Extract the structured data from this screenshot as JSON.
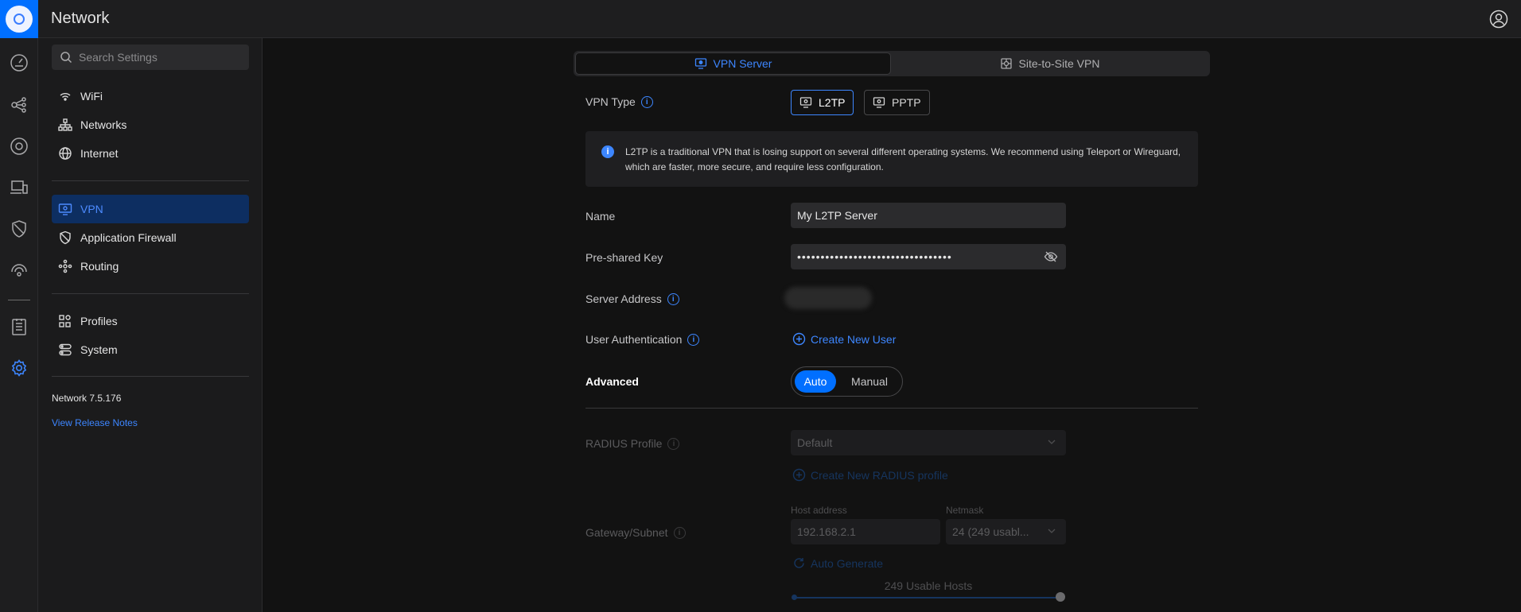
{
  "app": {
    "title": "Network"
  },
  "sidebar": {
    "search_placeholder": "Search Settings",
    "groups": [
      [
        {
          "label": "WiFi",
          "icon": "wifi-icon"
        },
        {
          "label": "Networks",
          "icon": "networks-icon"
        },
        {
          "label": "Internet",
          "icon": "globe-icon"
        }
      ],
      [
        {
          "label": "VPN",
          "icon": "vpn-icon",
          "active": true
        },
        {
          "label": "Application Firewall",
          "icon": "shield-icon"
        },
        {
          "label": "Routing",
          "icon": "routing-icon"
        }
      ],
      [
        {
          "label": "Profiles",
          "icon": "profiles-icon"
        },
        {
          "label": "System",
          "icon": "system-icon"
        }
      ]
    ],
    "version": "Network 7.5.176",
    "release_notes": "View Release Notes"
  },
  "main": {
    "tabs": [
      {
        "label": "VPN Server",
        "active": true
      },
      {
        "label": "Site-to-Site VPN",
        "active": false
      }
    ],
    "vpn_type": {
      "label": "VPN Type",
      "options": [
        "L2TP",
        "PPTP"
      ],
      "selected": "L2TP"
    },
    "banner": "L2TP is a traditional VPN that is losing support on several different operating systems. We recommend using Teleport or Wireguard, which are faster, more secure, and require less configuration.",
    "name": {
      "label": "Name",
      "value": "My L2TP Server"
    },
    "psk": {
      "label": "Pre-shared Key",
      "value": "•••••••••••••••••••••••••••••••••"
    },
    "server_address": {
      "label": "Server Address"
    },
    "user_auth": {
      "label": "User Authentication",
      "link": "Create New User"
    },
    "advanced": {
      "label": "Advanced",
      "options": [
        "Auto",
        "Manual"
      ],
      "selected": "Auto"
    },
    "radius": {
      "label": "RADIUS Profile",
      "value": "Default",
      "link": "Create New RADIUS profile"
    },
    "gateway": {
      "label": "Gateway/Subnet",
      "host_label": "Host address",
      "host_value": "192.168.2.1",
      "netmask_label": "Netmask",
      "netmask_value": "24 (249 usabl...",
      "auto_generate": "Auto Generate",
      "usable_hosts": "249 Usable Hosts"
    }
  },
  "colors": {
    "accent": "#006fff",
    "link": "#3d86ff",
    "active_nav_bg": "#0d2e61",
    "background": "#121212"
  }
}
